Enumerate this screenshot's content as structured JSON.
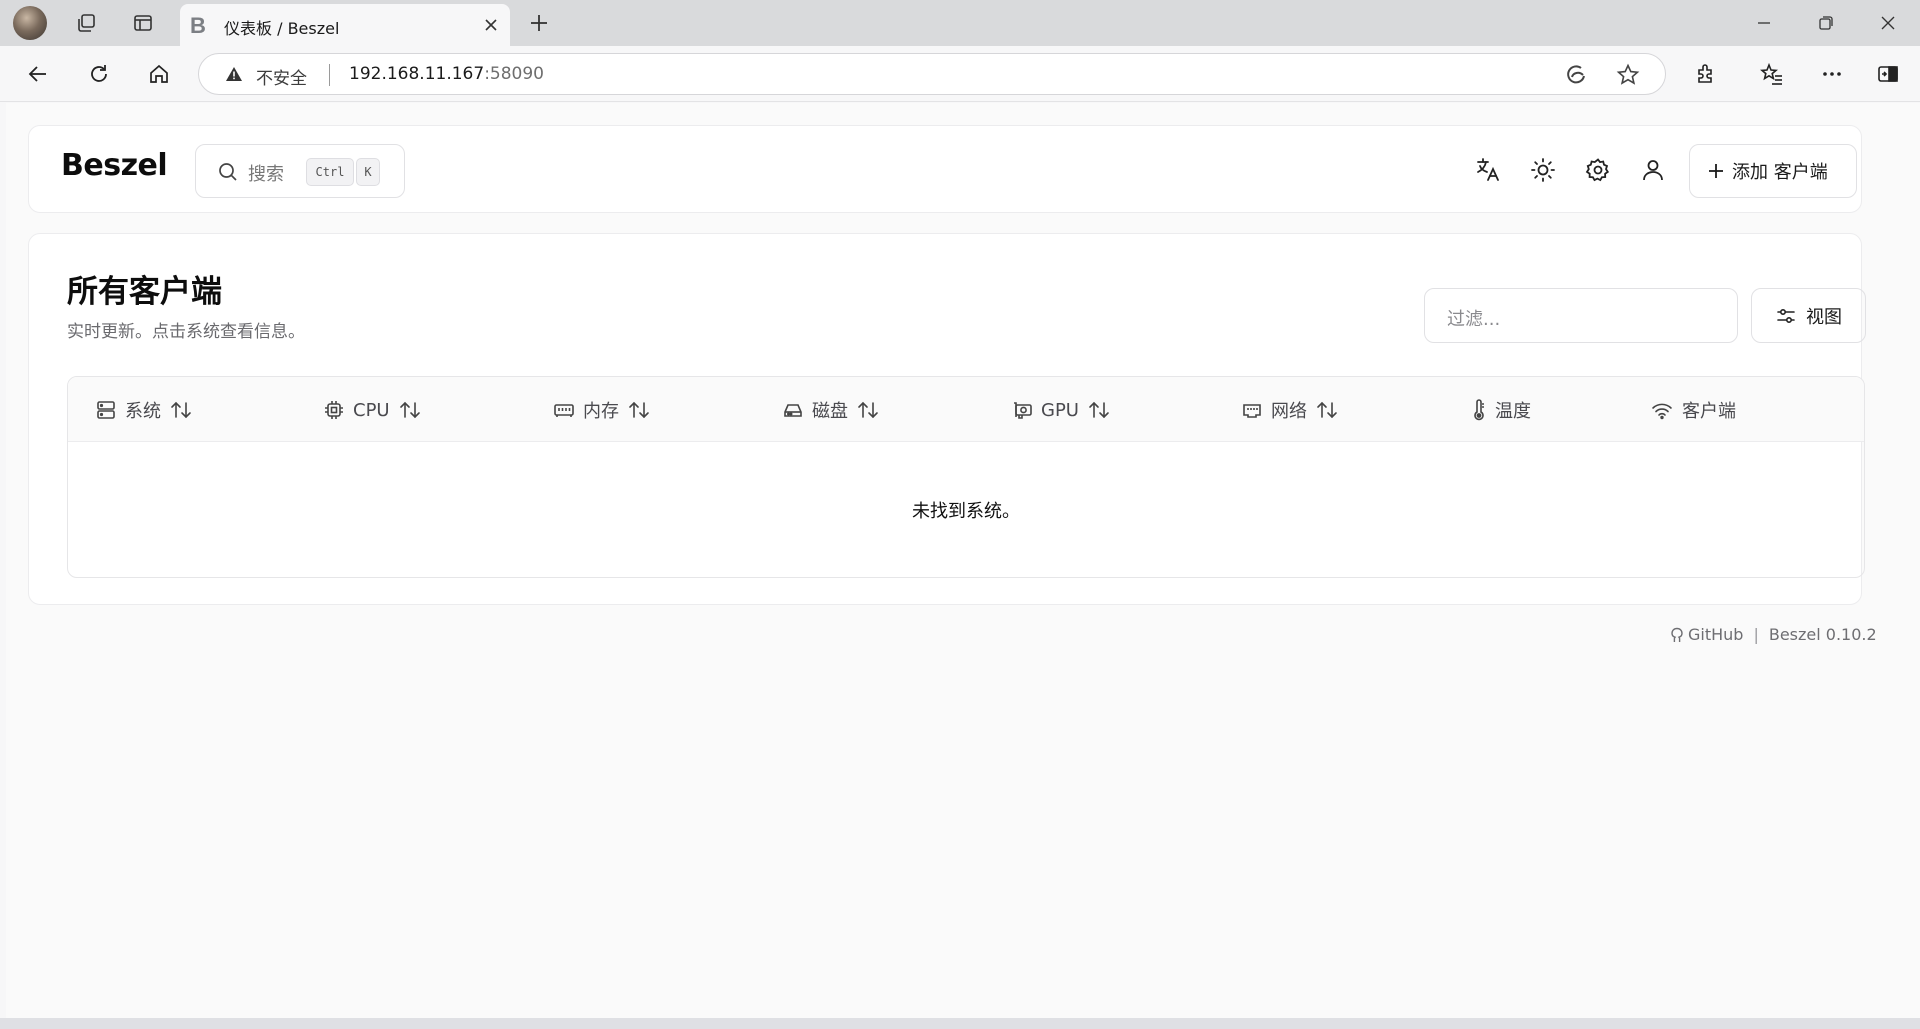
{
  "browser": {
    "tab_favicon": "B",
    "tab_title": "仪表板 / Beszel",
    "security_label": "不安全",
    "url_host": "192.168.11.167",
    "url_port": ":58090",
    "icons": [
      "profile-avatar",
      "workspaces-icon",
      "tab-actions-icon",
      "close-icon",
      "plus-icon",
      "minimize-icon",
      "restore-icon",
      "close-window-icon",
      "back-icon",
      "refresh-icon",
      "home-icon",
      "warning-icon",
      "edge-icon",
      "star-icon",
      "extensions-icon",
      "favorites-icon",
      "more-icon",
      "sidebar-icon"
    ]
  },
  "header": {
    "logo": "Beszel",
    "search_placeholder": "搜索",
    "search_kbd_1": "Ctrl",
    "search_kbd_2": "K",
    "add_button_label": "添加 客户端"
  },
  "main": {
    "title": "所有客户端",
    "subtitle": "实时更新。点击系统查看信息。",
    "filter_placeholder": "过滤...",
    "view_button_label": "视图",
    "columns": [
      {
        "label": "系统",
        "icon": "server-icon",
        "sortable": true
      },
      {
        "label": "CPU",
        "icon": "cpu-icon",
        "sortable": true
      },
      {
        "label": "内存",
        "icon": "memory-icon",
        "sortable": true
      },
      {
        "label": "磁盘",
        "icon": "disk-icon",
        "sortable": true
      },
      {
        "label": "GPU",
        "icon": "gpu-icon",
        "sortable": true
      },
      {
        "label": "网络",
        "icon": "network-icon",
        "sortable": true
      },
      {
        "label": "温度",
        "icon": "thermometer-icon",
        "sortable": false
      },
      {
        "label": "客户端",
        "icon": "wifi-icon",
        "sortable": false
      }
    ],
    "empty_message": "未找到系统。"
  },
  "footer": {
    "github_label": "GitHub",
    "version_label": "Beszel 0.10.2"
  },
  "colors": {
    "annotation_arrow": "#e8352b",
    "page_background": "#fafafa"
  }
}
